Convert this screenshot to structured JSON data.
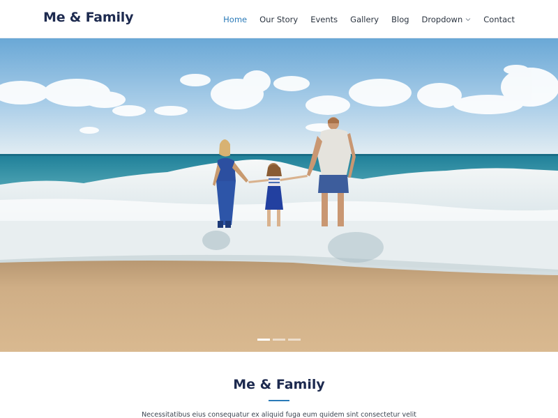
{
  "site": {
    "logo": "Me & Family"
  },
  "nav": {
    "items": [
      {
        "label": "Home",
        "active": true
      },
      {
        "label": "Our Story",
        "active": false
      },
      {
        "label": "Events",
        "active": false
      },
      {
        "label": "Gallery",
        "active": false
      },
      {
        "label": "Blog",
        "active": false
      },
      {
        "label": "Dropdown",
        "active": false,
        "icon": "chevron-down-icon"
      },
      {
        "label": "Contact",
        "active": false
      }
    ]
  },
  "hero": {
    "image": "family-walking-on-beach-photo",
    "slides_total": 3,
    "active_slide": 1
  },
  "about": {
    "title": "Me & Family",
    "text": "Necessitatibus eius consequatur ex aliquid fuga eum quidem sint consectetur velit"
  },
  "colors": {
    "accent": "#2a7ab8",
    "heading": "#1d2a4f"
  }
}
